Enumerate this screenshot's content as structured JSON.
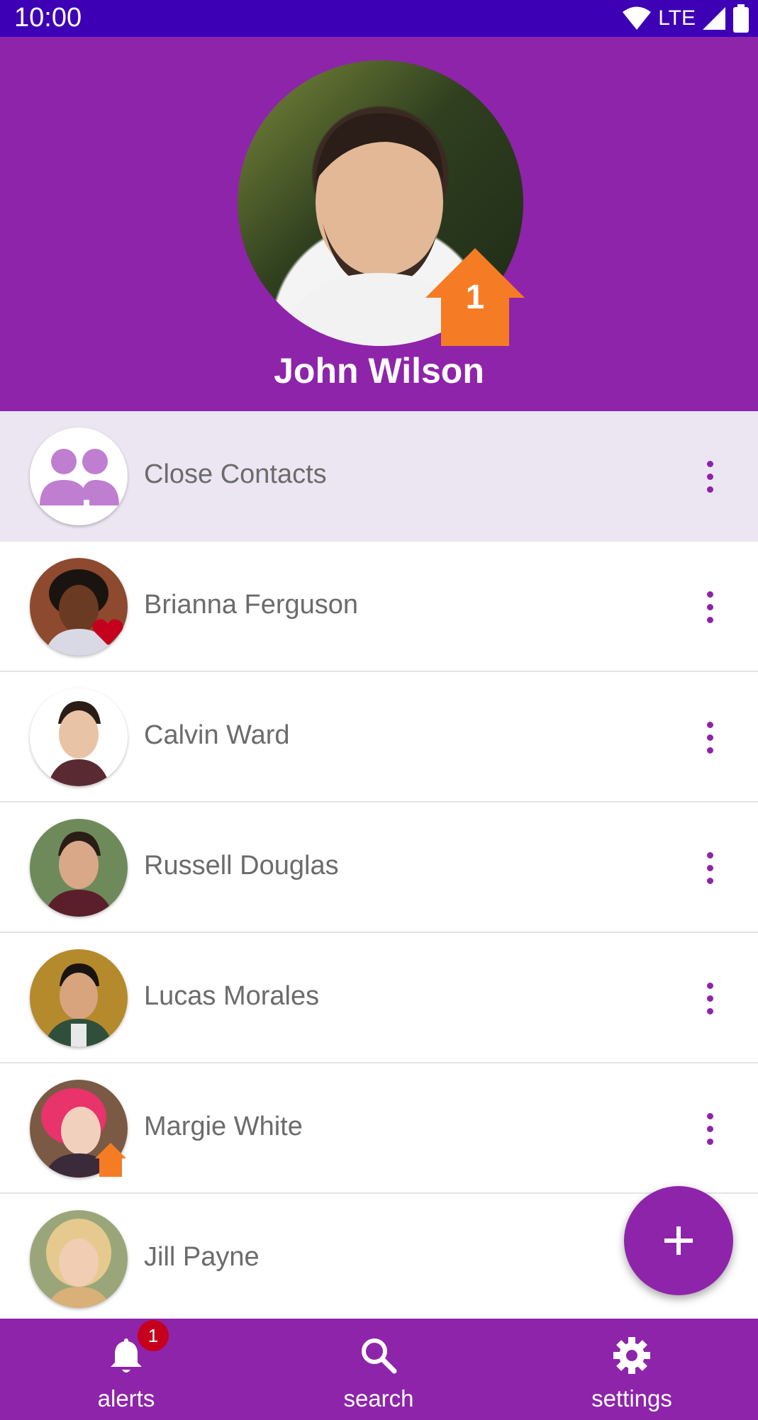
{
  "status_bar": {
    "time": "10:00",
    "network": "LTE"
  },
  "profile": {
    "name": "John Wilson",
    "home_badge_count": "1"
  },
  "contacts": [
    {
      "name": "Close Contacts",
      "type": "group",
      "selected": true
    },
    {
      "name": "Brianna Ferguson",
      "badge": "heart-icon"
    },
    {
      "name": "Calvin Ward"
    },
    {
      "name": "Russell Douglas"
    },
    {
      "name": "Lucas Morales"
    },
    {
      "name": "Margie White",
      "badge": "home-icon"
    },
    {
      "name": "Jill Payne"
    }
  ],
  "fab": {
    "icon": "plus-icon"
  },
  "bottom_nav": {
    "alerts": {
      "label": "alerts",
      "badge": "1"
    },
    "search": {
      "label": "search"
    },
    "settings": {
      "label": "settings"
    }
  },
  "colors": {
    "primary": "#8e24aa",
    "status_bar": "#3d00b5",
    "selected_row": "#ece6f3",
    "home_badge": "#f57c25",
    "heart": "#c4001d"
  }
}
